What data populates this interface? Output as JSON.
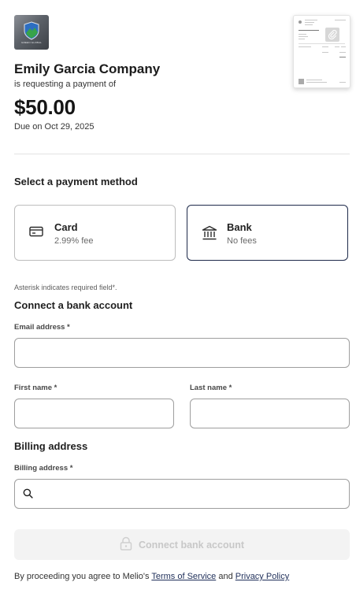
{
  "logo_text": "GREEN GLOBAL",
  "vendor": {
    "company_name": "Emily Garcia Company",
    "requesting_text": "is requesting a payment of",
    "amount": "$50.00",
    "due_text": "Due on Oct 29, 2025"
  },
  "payment_methods": {
    "title": "Select a payment method",
    "card": {
      "name": "Card",
      "fee": "2.99% fee",
      "icon": "credit-card-icon"
    },
    "bank": {
      "name": "Bank",
      "fee": "No fees",
      "icon": "bank-icon",
      "selected": true
    }
  },
  "form": {
    "asterisk_note": "Asterisk indicates required field*.",
    "connect_title": "Connect a bank account",
    "email_label": "Email address *",
    "email_value": "",
    "first_name_label": "First name *",
    "first_name_value": "",
    "last_name_label": "Last name *",
    "last_name_value": "",
    "billing_title": "Billing address",
    "billing_label": "Billing address *",
    "billing_value": ""
  },
  "connect_button": {
    "label": "Connect bank account",
    "icon": "lock-icon",
    "disabled": true
  },
  "legal": {
    "prefix": "By proceeding you agree to Melio's",
    "terms": "Terms of Service",
    "and": "and",
    "privacy": "Privacy Policy"
  },
  "colors": {
    "selected_border": "#1e2a4a",
    "disabled_bg": "#f3f3f3",
    "disabled_text": "#c8c8c8",
    "link": "#1f2f5a"
  }
}
